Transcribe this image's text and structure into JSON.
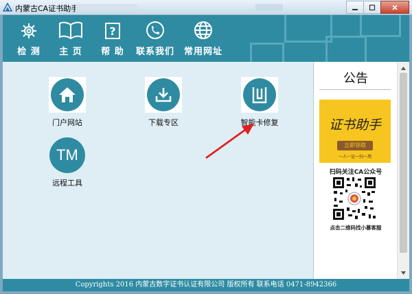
{
  "window": {
    "title": "内蒙古CA证书助手",
    "minimize_icon": "minimize-icon",
    "restore_icon": "restore-icon",
    "close_icon": "close-icon"
  },
  "nav": [
    {
      "label": "检 测",
      "icon": "gear-icon"
    },
    {
      "label": "主 页",
      "icon": "book-icon"
    },
    {
      "label": "帮 助",
      "icon": "question-icon"
    },
    {
      "label": "联系我们",
      "icon": "phone-icon"
    },
    {
      "label": "常用网址",
      "icon": "globe-icon"
    }
  ],
  "tiles": [
    {
      "label": "门户网站",
      "icon": "home-icon"
    },
    {
      "label": "下载专区",
      "icon": "download-icon"
    },
    {
      "label": "智能卡修复",
      "icon": "card-repair-icon"
    },
    {
      "label": "远程工具",
      "icon": "tm-icon",
      "icon_text": "TM"
    }
  ],
  "notice": {
    "title": "公告",
    "banner_title": "证书助手",
    "banner_button": "立即领取",
    "banner_sub": "一人一证一扫一用",
    "qr_caption": "扫码关注CA公众号",
    "qr_caption2": "点击二维码找小慕客服"
  },
  "footer": "Copyrights 2016 内蒙古数字证书认证有限公司 版权所有   联系电话  0471-8942366",
  "colors": {
    "primary": "#2e8ba2",
    "background": "#dfeef5",
    "arrow": "#e02020",
    "banner": "#f7c51f"
  }
}
